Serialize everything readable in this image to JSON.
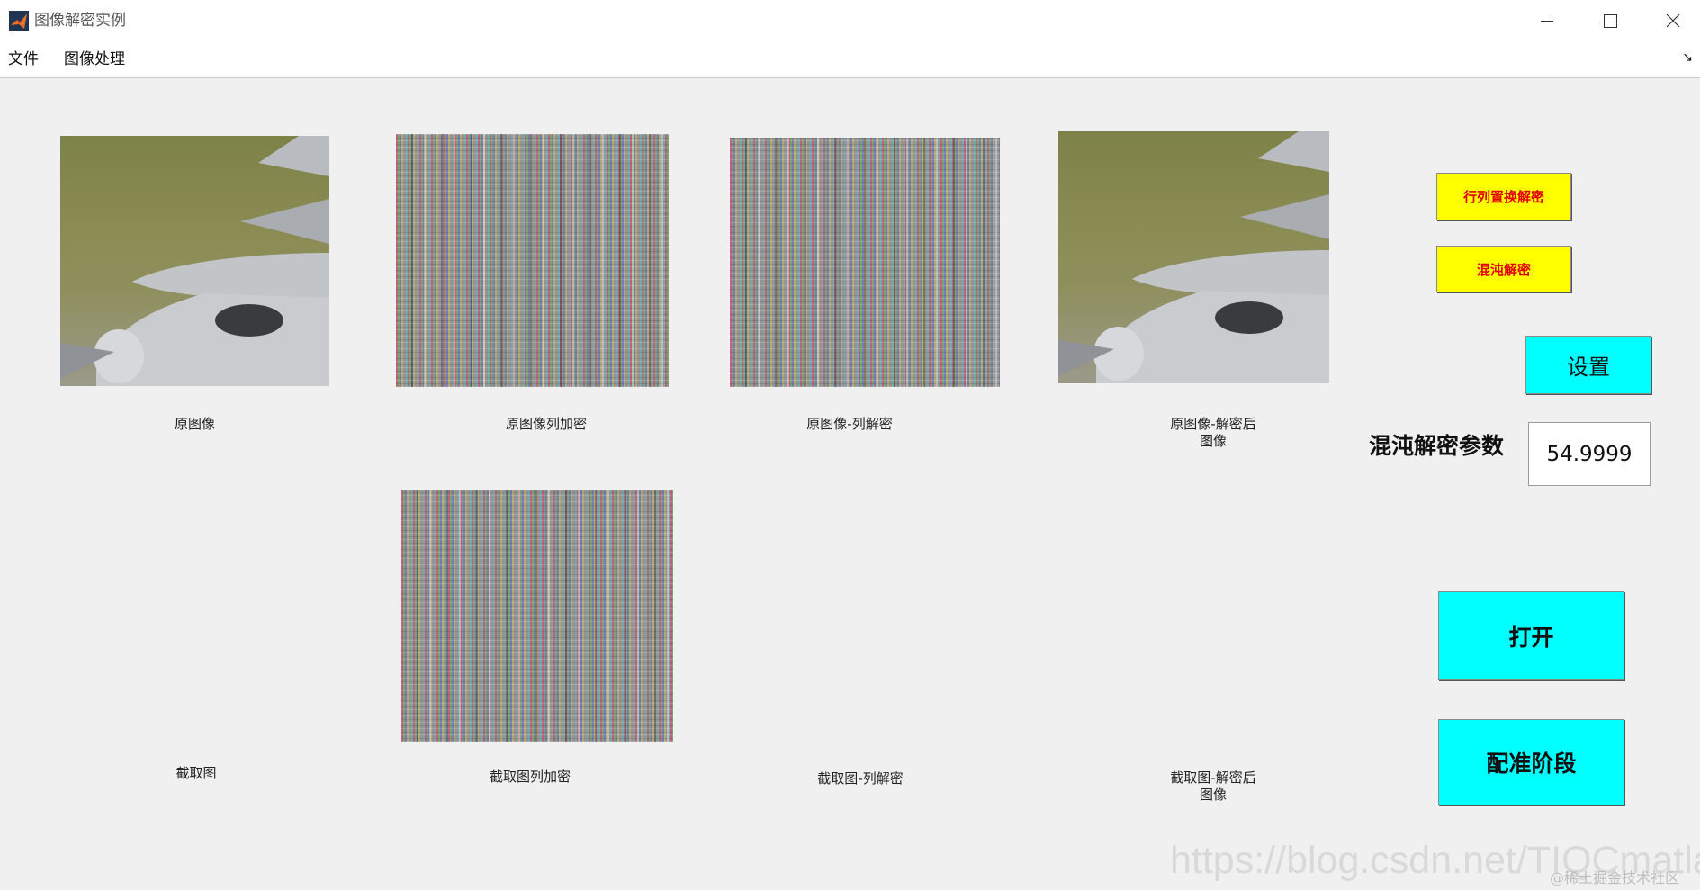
{
  "window": {
    "title": "图像解密实例"
  },
  "menu": {
    "file": "文件",
    "image_processing": "图像处理"
  },
  "panels": {
    "original": "原图像",
    "original_col_encrypt": "原图像列加密",
    "original_col_decrypt": "原图像-列解密",
    "original_decrypted_line1": "原图像-解密后",
    "original_decrypted_line2": "图像",
    "crop": "截取图",
    "crop_col_encrypt": "截取图列加密",
    "crop_col_decrypt": "截取图-列解密",
    "crop_decrypted_line1": "截取图-解密后",
    "crop_decrypted_line2": "图像"
  },
  "buttons": {
    "row_col_permutation_decrypt": "行列置换解密",
    "chaos_decrypt": "混沌解密",
    "settings": "设置",
    "open": "打开",
    "registration_stage": "配准阶段"
  },
  "params": {
    "label": "混沌解密参数",
    "value": "54.9999"
  },
  "watermark": {
    "url": "https://blog.csdn.net/TIQCmatlab",
    "community": "@稀土掘金技术社区"
  },
  "colors": {
    "button_yellow": "#ffff00",
    "button_yellow_text": "#e00000",
    "button_cyan": "#00ffff",
    "background": "#f0f0f0"
  }
}
